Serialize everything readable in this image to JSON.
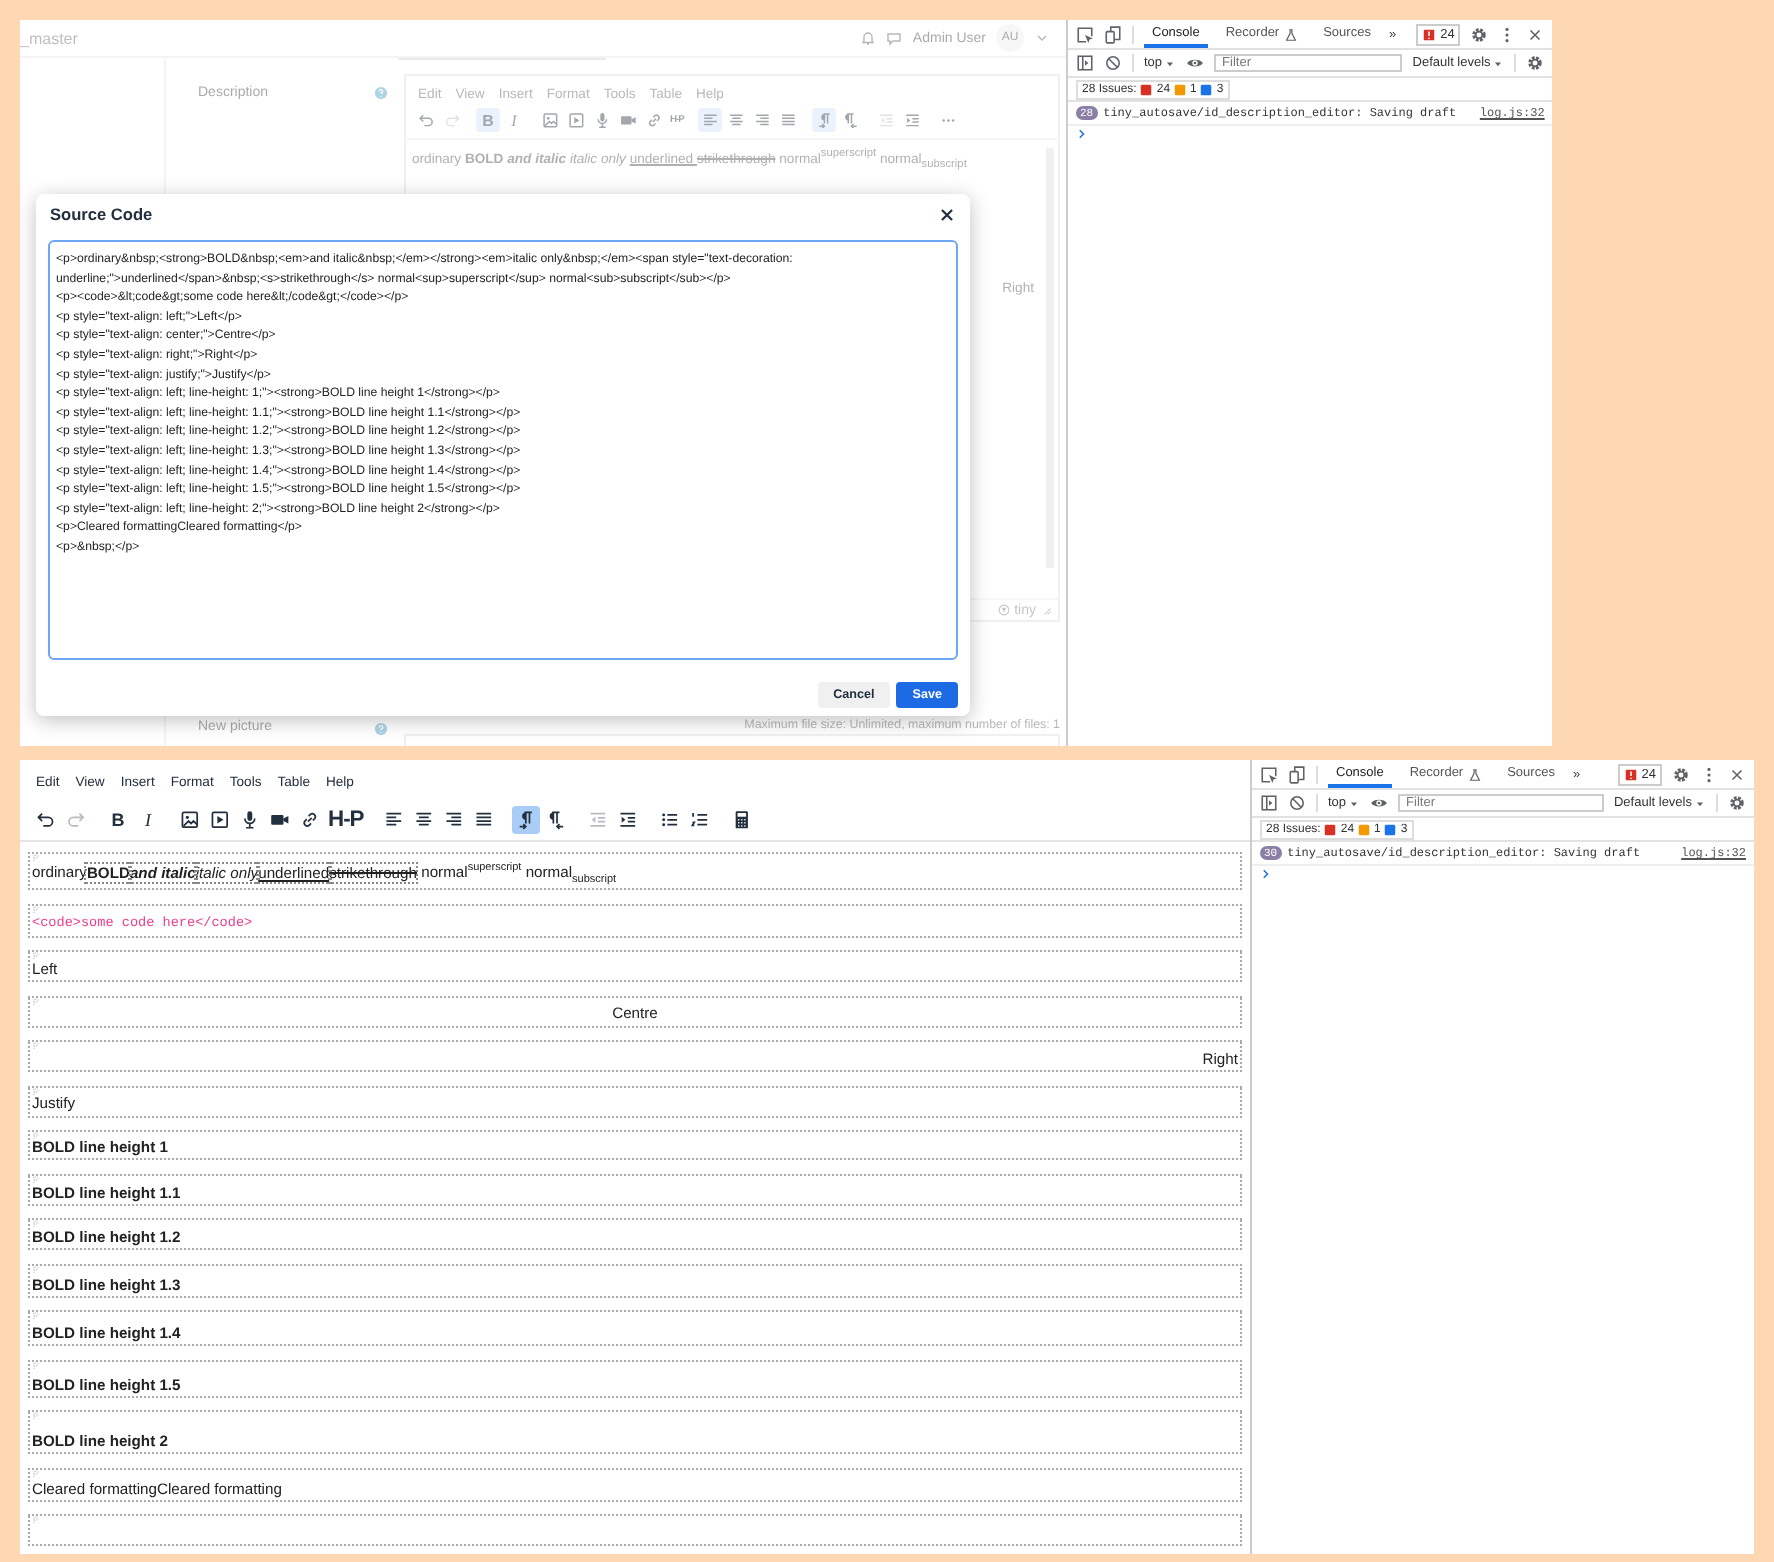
{
  "top": {
    "header": {
      "title": "_master",
      "user": "Admin User",
      "initials": "AU"
    },
    "description_label": "Description",
    "editor": {
      "menu": [
        "Edit",
        "View",
        "Insert",
        "Format",
        "Tools",
        "Table",
        "Help"
      ],
      "toolbar": [
        {
          "buttons": [
            {
              "kind": "undo",
              "selected": false,
              "disabled": false
            },
            {
              "kind": "redo",
              "selected": false,
              "disabled": true
            }
          ]
        },
        {
          "buttons": [
            {
              "kind": "bold",
              "label": "B",
              "selected": true,
              "disabled": false
            },
            {
              "kind": "italic",
              "label": "I",
              "selected": false,
              "disabled": false
            }
          ]
        },
        {
          "buttons": [
            {
              "kind": "image",
              "selected": false,
              "disabled": false
            },
            {
              "kind": "media",
              "selected": false,
              "disabled": false
            },
            {
              "kind": "mic",
              "selected": false,
              "disabled": false
            },
            {
              "kind": "video",
              "selected": false,
              "disabled": false
            },
            {
              "kind": "link",
              "selected": false,
              "disabled": false
            },
            {
              "kind": "text",
              "label": "H-P",
              "selected": false,
              "disabled": false
            }
          ]
        },
        {
          "buttons": [
            {
              "kind": "alignleft",
              "selected": true,
              "disabled": false
            },
            {
              "kind": "aligncenter",
              "selected": false,
              "disabled": false
            },
            {
              "kind": "alignright",
              "selected": false,
              "disabled": false
            },
            {
              "kind": "alignjustify",
              "selected": false,
              "disabled": false
            }
          ]
        },
        {
          "buttons": [
            {
              "kind": "ltr",
              "selected": true,
              "disabled": false
            },
            {
              "kind": "rtl",
              "selected": false,
              "disabled": false
            }
          ]
        },
        {
          "buttons": [
            {
              "kind": "outdent",
              "selected": false,
              "disabled": true
            },
            {
              "kind": "indent",
              "selected": false,
              "disabled": false
            }
          ]
        },
        {
          "buttons": [
            {
              "kind": "more",
              "selected": false,
              "disabled": false
            }
          ]
        }
      ],
      "content": [
        {
          "kind": "plain",
          "text": "ordinary "
        },
        {
          "kind": "bold",
          "text": "BOLD "
        },
        {
          "kind": "bolditalic",
          "text": "and italic "
        },
        {
          "kind": "italic",
          "text": "italic only "
        },
        {
          "kind": "underline",
          "text": "underlined "
        },
        {
          "kind": "strike",
          "text": "strikethrough"
        },
        {
          "kind": "plain",
          "text": " normal"
        },
        {
          "kind": "sup",
          "text": "superscript"
        },
        {
          "kind": "plain",
          "text": " normal"
        },
        {
          "kind": "sub",
          "text": "subscript"
        }
      ],
      "right_text": "Right",
      "brand": "tiny"
    },
    "picture_label": "New picture",
    "file_limit": "Maximum file size: Unlimited, maximum number of files: 1",
    "dialog": {
      "title": "Source Code",
      "code_lines": [
        "<p>ordinary&nbsp;<strong>BOLD&nbsp;<em>and italic&nbsp;</em></strong><em>italic only&nbsp;</em><span style=\"text-decoration: underline;\">underlined</span>&nbsp;<s>strikethrough</s> normal<sup>superscript</sup> normal<sub>subscript</sub></p>",
        "<p><code>&lt;code&gt;some code here&lt;/code&gt;</code></p>",
        "<p style=\"text-align: left;\">Left</p>",
        "<p style=\"text-align: center;\">Centre</p>",
        "<p style=\"text-align: right;\">Right</p>",
        "<p style=\"text-align: justify;\">Justify</p>",
        "<p style=\"text-align: left; line-height: 1;\"><strong>BOLD line height 1</strong></p>",
        "<p style=\"text-align: left; line-height: 1.1;\"><strong>BOLD line height 1.1</strong></p>",
        "<p style=\"text-align: left; line-height: 1.2;\"><strong>BOLD line height 1.2</strong></p>",
        "<p style=\"text-align: left; line-height: 1.3;\"><strong>BOLD line height 1.3</strong></p>",
        "<p style=\"text-align: left; line-height: 1.4;\"><strong>BOLD line height 1.4</strong></p>",
        "<p style=\"text-align: left; line-height: 1.5;\"><strong>BOLD line height 1.5</strong></p>",
        "<p style=\"text-align: left; line-height: 2;\"><strong>BOLD line height 2</strong></p>",
        "<p>Cleared formattingCleared formatting</p>",
        "<p>&nbsp;</p>"
      ],
      "buttons": [
        {
          "label": "Cancel",
          "kind": "secondary"
        },
        {
          "label": "Save",
          "kind": "primary"
        }
      ]
    },
    "devtools": {
      "tabs": [
        {
          "label": "Console",
          "selected": true
        },
        {
          "label": "Recorder",
          "selected": false
        },
        {
          "label": "Sources",
          "selected": false
        }
      ],
      "more": "»",
      "error_count": "24",
      "context": "top",
      "filter_placeholder": "Filter",
      "levels": "Default levels",
      "issues_label": "28 Issues:",
      "issue_counts": [
        {
          "count": "24",
          "color": "#d93025"
        },
        {
          "count": "1",
          "color": "#f29900"
        },
        {
          "count": "3",
          "color": "#1a73e8"
        }
      ],
      "messages": [
        {
          "repeat": "28",
          "text": "tiny_autosave/id_description_editor: Saving draft",
          "source": "log.js:32"
        }
      ]
    }
  },
  "bottom": {
    "editor": {
      "menu": [
        "Edit",
        "View",
        "Insert",
        "Format",
        "Tools",
        "Table",
        "Help"
      ],
      "toolbar": [
        {
          "buttons": [
            {
              "kind": "undo",
              "selected": false,
              "disabled": false
            },
            {
              "kind": "redo",
              "selected": false,
              "disabled": true
            }
          ]
        },
        {
          "buttons": [
            {
              "kind": "bold",
              "label": "B",
              "selected": false,
              "disabled": false
            },
            {
              "kind": "italic",
              "label": "I",
              "selected": false,
              "disabled": false
            }
          ]
        },
        {
          "buttons": [
            {
              "kind": "image",
              "selected": false,
              "disabled": false
            },
            {
              "kind": "media",
              "selected": false,
              "disabled": false
            },
            {
              "kind": "mic",
              "selected": false,
              "disabled": false
            },
            {
              "kind": "video",
              "selected": false,
              "disabled": false
            },
            {
              "kind": "link",
              "selected": false,
              "disabled": false
            },
            {
              "kind": "text",
              "label": "H-P",
              "selected": false,
              "disabled": false
            }
          ]
        },
        {
          "buttons": [
            {
              "kind": "alignleft",
              "selected": false,
              "disabled": false
            },
            {
              "kind": "aligncenter",
              "selected": false,
              "disabled": false
            },
            {
              "kind": "alignright",
              "selected": false,
              "disabled": false
            },
            {
              "kind": "alignjustify",
              "selected": false,
              "disabled": false
            }
          ]
        },
        {
          "buttons": [
            {
              "kind": "ltr",
              "selected": true,
              "disabled": false
            },
            {
              "kind": "rtl",
              "selected": false,
              "disabled": false
            }
          ]
        },
        {
          "buttons": [
            {
              "kind": "outdent",
              "selected": false,
              "disabled": true
            },
            {
              "kind": "indent",
              "selected": false,
              "disabled": false
            }
          ]
        },
        {
          "buttons": [
            {
              "kind": "bullist",
              "selected": false,
              "disabled": false
            },
            {
              "kind": "numlist",
              "selected": false,
              "disabled": false
            }
          ]
        },
        {
          "buttons": [
            {
              "kind": "calc",
              "selected": false,
              "disabled": false
            }
          ]
        }
      ],
      "blocks": [
        {
          "kind": "rich",
          "segments": [
            {
              "kind": "plain",
              "text": "ordinary"
            },
            {
              "kind": "bold",
              "text": "BOLD"
            },
            {
              "kind": "bolditalic",
              "text": "and italic"
            },
            {
              "kind": "italic",
              "text": "italic only"
            },
            {
              "kind": "underline",
              "text": "underlined"
            },
            {
              "kind": "strike",
              "text": "strikethrough"
            },
            {
              "kind": "plain",
              "text": " normal"
            },
            {
              "kind": "sup",
              "text": "superscript"
            },
            {
              "kind": "plain",
              "text": " normal"
            },
            {
              "kind": "sub",
              "text": "subscript"
            }
          ]
        },
        {
          "kind": "code",
          "text": "<code>some code here</code>"
        },
        {
          "kind": "left",
          "text": "Left"
        },
        {
          "kind": "center",
          "text": "Centre"
        },
        {
          "kind": "right",
          "text": "Right"
        },
        {
          "kind": "justify",
          "text": "Justify"
        },
        {
          "kind": "bold",
          "text": "BOLD line height 1"
        },
        {
          "kind": "bold",
          "text": "BOLD line height 1.1"
        },
        {
          "kind": "bold",
          "text": "BOLD line height 1.2"
        },
        {
          "kind": "bold",
          "text": "BOLD line height 1.3"
        },
        {
          "kind": "bold",
          "text": "BOLD line height 1.4"
        },
        {
          "kind": "bold",
          "text": "BOLD line height 1.5"
        },
        {
          "kind": "bold",
          "text": "BOLD line height 2"
        },
        {
          "kind": "left",
          "text": "Cleared formattingCleared formatting"
        },
        {
          "kind": "empty"
        }
      ]
    },
    "devtools": {
      "tabs": [
        {
          "label": "Console",
          "selected": true
        },
        {
          "label": "Recorder",
          "selected": false
        },
        {
          "label": "Sources",
          "selected": false
        }
      ],
      "more": "»",
      "error_count": "24",
      "context": "top",
      "filter_placeholder": "Filter",
      "levels": "Default levels",
      "issues_label": "28 Issues:",
      "issue_counts": [
        {
          "count": "24",
          "color": "#d93025"
        },
        {
          "count": "1",
          "color": "#f29900"
        },
        {
          "count": "3",
          "color": "#1a73e8"
        }
      ],
      "messages": [
        {
          "repeat": "30",
          "text": "tiny_autosave/id_description_editor: Saving draft",
          "source": "log.js:32"
        }
      ]
    }
  }
}
